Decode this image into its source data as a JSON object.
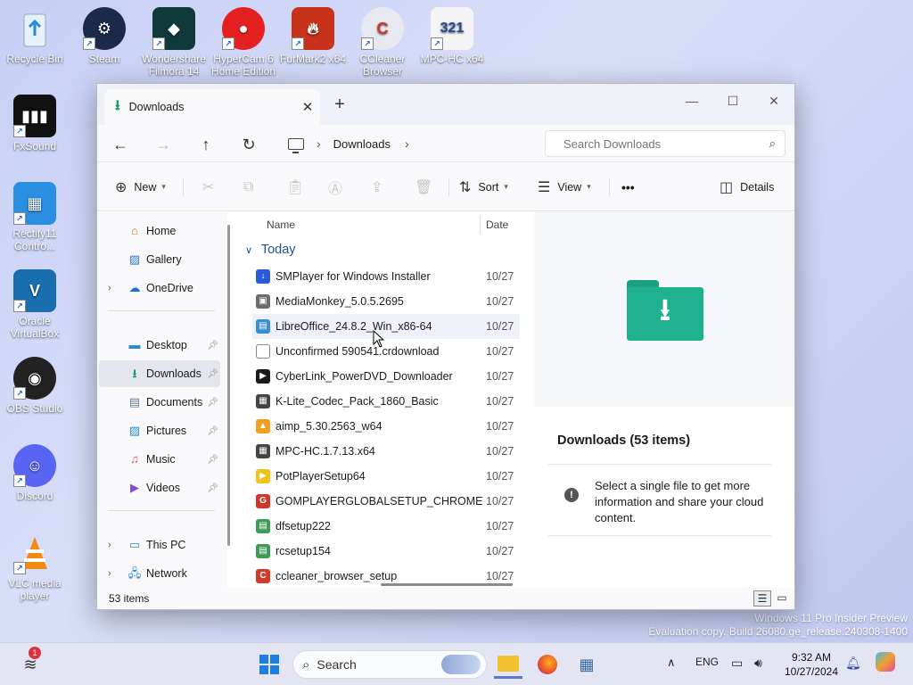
{
  "desktop": {
    "icons": [
      {
        "label": "Recycle Bin",
        "icon": "recycle-bin-icon"
      },
      {
        "label": "Steam",
        "icon": "steam-icon"
      },
      {
        "label": "Wondershare Filmora 14",
        "icon": "filmora-icon"
      },
      {
        "label": "HyperCam 6 Home Edition",
        "icon": "hypercam-icon"
      },
      {
        "label": "FurMark2 x64",
        "icon": "furmark-icon"
      },
      {
        "label": "CCleaner Browser",
        "icon": "ccleaner-browser-icon"
      },
      {
        "label": "MPC-HC x64",
        "icon": "mpc-hc-icon"
      },
      {
        "label": "FxSound",
        "icon": "fxsound-icon"
      },
      {
        "label": "Rectify11 Contro...",
        "icon": "rectify11-icon"
      },
      {
        "label": "Oracle VirtualBox",
        "icon": "virtualbox-icon"
      },
      {
        "label": "OBS Studio",
        "icon": "obs-icon"
      },
      {
        "label": "Discord",
        "icon": "discord-icon"
      },
      {
        "label": "VLC media player",
        "icon": "vlc-icon"
      }
    ],
    "watermark_line1": "Windows 11 Pro Insider Preview",
    "watermark_line2": "Evaluation copy. Build 26080.ge_release.240308-1400"
  },
  "explorer": {
    "tab_title": "Downloads",
    "new_tab": "+",
    "controls": {
      "minimize": "—",
      "maximize": "☐",
      "close": "✕"
    },
    "breadcrumb": [
      "Downloads"
    ],
    "search_placeholder": "Search Downloads",
    "command_bar": {
      "new_label": "New",
      "sort_label": "Sort",
      "view_label": "View",
      "more_label": "•••",
      "details_label": "Details"
    },
    "nav": {
      "home": "Home",
      "gallery": "Gallery",
      "onedrive": "OneDrive",
      "desktop": "Desktop",
      "downloads": "Downloads",
      "documents": "Documents",
      "pictures": "Pictures",
      "music": "Music",
      "videos": "Videos",
      "this_pc": "This PC",
      "network": "Network"
    },
    "columns": {
      "name": "Name",
      "date": "Date"
    },
    "group_label": "Today",
    "files": [
      {
        "name": "SMPlayer for Windows Installer",
        "date": "10/27",
        "color": "#2a5bd7",
        "glyph": "↓"
      },
      {
        "name": "MediaMonkey_5.0.5.2695",
        "date": "10/27",
        "color": "#6b6b6b",
        "glyph": "▣"
      },
      {
        "name": "LibreOffice_24.8.2_Win_x86-64",
        "date": "10/27",
        "color": "#3a8fd0",
        "glyph": "▤"
      },
      {
        "name": "Unconfirmed 590541.crdownload",
        "date": "10/27",
        "color": "#ffffff",
        "glyph": ""
      },
      {
        "name": "CyberLink_PowerDVD_Downloader",
        "date": "10/27",
        "color": "#1a1a1a",
        "glyph": "▶"
      },
      {
        "name": "K-Lite_Codec_Pack_1860_Basic",
        "date": "10/27",
        "color": "#444444",
        "glyph": "▦"
      },
      {
        "name": "aimp_5.30.2563_w64",
        "date": "10/27",
        "color": "#f0a020",
        "glyph": "▲"
      },
      {
        "name": "MPC-HC.1.7.13.x64",
        "date": "10/27",
        "color": "#444444",
        "glyph": "▦"
      },
      {
        "name": "PotPlayerSetup64",
        "date": "10/27",
        "color": "#f2c21a",
        "glyph": "▶"
      },
      {
        "name": "GOMPLAYERGLOBALSETUP_CHROME",
        "date": "10/27",
        "color": "#d2362a",
        "glyph": "G"
      },
      {
        "name": "dfsetup222",
        "date": "10/27",
        "color": "#3d9b5a",
        "glyph": "▤"
      },
      {
        "name": "rcsetup154",
        "date": "10/27",
        "color": "#3d9b5a",
        "glyph": "▤"
      },
      {
        "name": "ccleaner_browser_setup",
        "date": "10/27",
        "color": "#d23a2a",
        "glyph": "C"
      }
    ],
    "preview": {
      "title": "Downloads (53 items)",
      "message": "Select a single file to get more information and share your cloud content."
    },
    "status_count": "53 items"
  },
  "taskbar": {
    "search_label": "Search",
    "badge_count": "1",
    "lang": "ENG",
    "time": "9:32 AM",
    "date": "10/27/2024"
  }
}
